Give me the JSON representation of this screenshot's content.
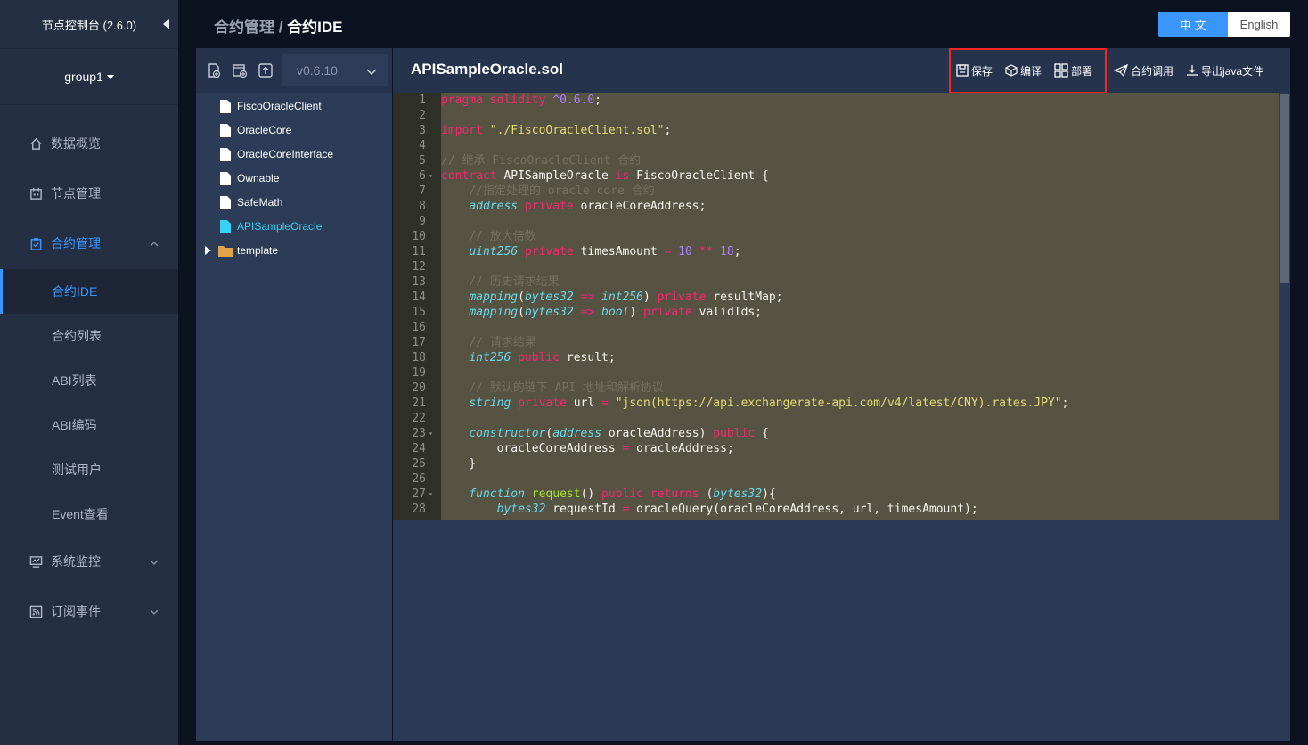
{
  "sidebar": {
    "title": "节点控制台 (2.6.0)",
    "group": "group1",
    "menu": {
      "overview": "数据概览",
      "node_mgmt": "节点管理",
      "contract_mgmt": "合约管理",
      "monitor": "系统监控",
      "subscribe": "订阅事件"
    },
    "sub_items": [
      "合约IDE",
      "合约列表",
      "ABI列表",
      "ABI编码",
      "测试用户",
      "Event查看"
    ]
  },
  "topbar": {
    "breadcrumb_parent": "合约管理",
    "breadcrumb_sep": " / ",
    "breadcrumb_current": "合约IDE",
    "lang_zh": "中 文",
    "lang_en": "English"
  },
  "file_panel": {
    "version": "v0.6.10",
    "files": [
      "FiscoOracleClient",
      "OracleCore",
      "OracleCoreInterface",
      "Ownable",
      "SafeMath",
      "APISampleOracle"
    ],
    "folder": "template"
  },
  "editor": {
    "file_title": "APISampleOracle.sol",
    "actions": {
      "save": "保存",
      "compile": "编译",
      "deploy": "部署",
      "invoke": "合约调用",
      "export": "导出java文件"
    }
  },
  "code_lines": [
    {
      "n": "1",
      "t": "pragma solidity ^0.6.0;"
    },
    {
      "n": "2",
      "t": ""
    },
    {
      "n": "3",
      "t": "import \"./FiscoOracleClient.sol\";"
    },
    {
      "n": "4",
      "t": ""
    },
    {
      "n": "5",
      "t": "// 继承 FiscoOracleClient 合约"
    },
    {
      "n": "6",
      "t": "contract APISampleOracle is FiscoOracleClient {"
    },
    {
      "n": "7",
      "t": "    //指定处理的 oracle core 合约"
    },
    {
      "n": "8",
      "t": "    address private oracleCoreAddress;"
    },
    {
      "n": "9",
      "t": ""
    },
    {
      "n": "10",
      "t": "    // 放大倍数"
    },
    {
      "n": "11",
      "t": "    uint256 private timesAmount = 10 ** 18;"
    },
    {
      "n": "12",
      "t": ""
    },
    {
      "n": "13",
      "t": "    // 历史请求结果"
    },
    {
      "n": "14",
      "t": "    mapping(bytes32 => int256) private resultMap;"
    },
    {
      "n": "15",
      "t": "    mapping(bytes32 => bool) private validIds;"
    },
    {
      "n": "16",
      "t": ""
    },
    {
      "n": "17",
      "t": "    // 请求结果"
    },
    {
      "n": "18",
      "t": "    int256 public result;"
    },
    {
      "n": "19",
      "t": ""
    },
    {
      "n": "20",
      "t": "    // 默认的链下 API 地址和解析协议"
    },
    {
      "n": "21",
      "t": "    string private url = \"json(https://api.exchangerate-api.com/v4/latest/CNY).rates.JPY\";"
    },
    {
      "n": "22",
      "t": ""
    },
    {
      "n": "23",
      "t": "    constructor(address oracleAddress) public {"
    },
    {
      "n": "24",
      "t": "        oracleCoreAddress = oracleAddress;"
    },
    {
      "n": "25",
      "t": "    }"
    },
    {
      "n": "26",
      "t": ""
    },
    {
      "n": "27",
      "t": "    function request() public returns (bytes32){"
    },
    {
      "n": "28",
      "t": "        bytes32 requestId = oracleQuery(oracleCoreAddress, url, timesAmount);"
    }
  ],
  "colors": {
    "accent": "#3a97ff",
    "active_file": "#38d1f4",
    "highlight_box": "#f22424"
  }
}
